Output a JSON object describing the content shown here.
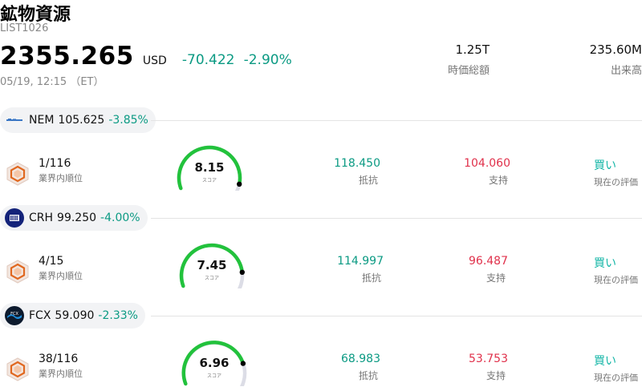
{
  "header": {
    "title": "鉱物資源",
    "code": "LIST1026",
    "price": "2355.265",
    "currency": "USD",
    "change": "-70.422",
    "change_pct": "-2.90%",
    "timestamp": "05/19, 12:15 （ET）",
    "market_cap_value": "1.25T",
    "market_cap_label": "時価総額",
    "volume_value": "235.60M",
    "volume_label": "出来高"
  },
  "colors": {
    "up_green": "#0b9a83",
    "support_red": "#e0314b",
    "rating_teal": "#12b5a6",
    "gauge_green": "#22c23c",
    "gauge_track": "#dcdde6"
  },
  "stocks": [
    {
      "ticker": "NEM",
      "price": "105.625",
      "change_pct": "-3.85%",
      "logo": "nem-logo",
      "rank": "1/116",
      "rank_label": "業界内順位",
      "score": "8.15",
      "score_value": 8.15,
      "score_label": "スコア",
      "resistance": "118.450",
      "resistance_label": "抵抗",
      "support": "104.060",
      "support_label": "支持",
      "rating": "買い",
      "rating_label": "現在の評価"
    },
    {
      "ticker": "CRH",
      "price": "99.250",
      "change_pct": "-4.00%",
      "logo": "crh-logo",
      "rank": "4/15",
      "rank_label": "業界内順位",
      "score": "7.45",
      "score_value": 7.45,
      "score_label": "スコア",
      "resistance": "114.997",
      "resistance_label": "抵抗",
      "support": "96.487",
      "support_label": "支持",
      "rating": "買い",
      "rating_label": "現在の評価"
    },
    {
      "ticker": "FCX",
      "price": "59.090",
      "change_pct": "-2.33%",
      "logo": "fcx-logo",
      "rank": "38/116",
      "rank_label": "業界内順位",
      "score": "6.96",
      "score_value": 6.96,
      "score_label": "スコア",
      "resistance": "68.983",
      "resistance_label": "抵抗",
      "support": "53.753",
      "support_label": "支持",
      "rating": "買い",
      "rating_label": "現在の評価"
    }
  ]
}
